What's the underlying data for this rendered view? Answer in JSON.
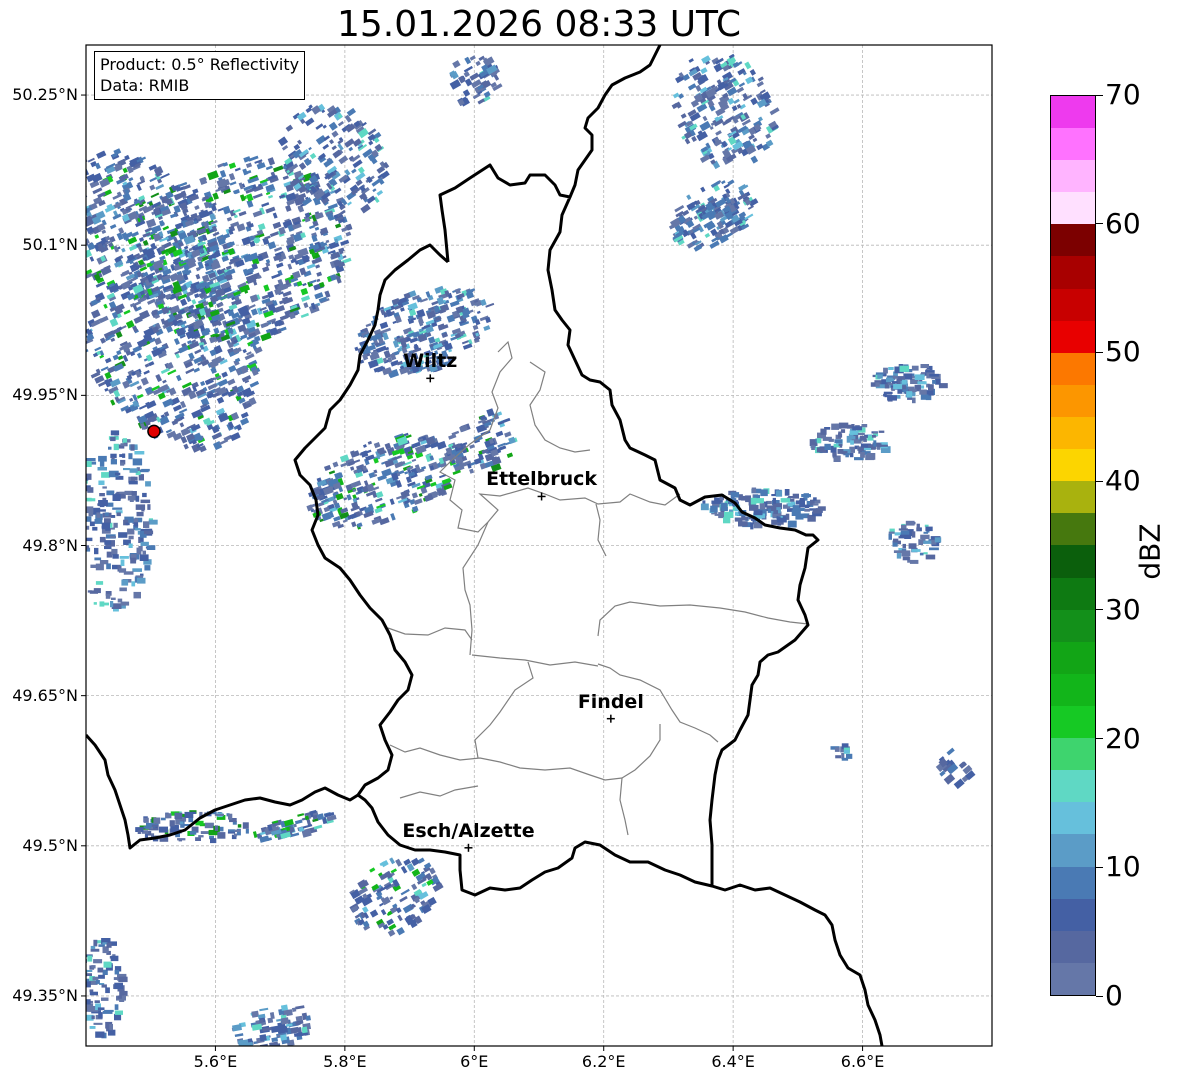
{
  "title": "15.01.2026 08:33 UTC",
  "info": {
    "product": "Product: 0.5° Reflectivity",
    "source": "Data: RMIB"
  },
  "map": {
    "lon_range": [
      5.4,
      6.8
    ],
    "lat_range": [
      49.3,
      50.3
    ],
    "x_ticks": [
      {
        "value": 5.6,
        "label": "5.6°E"
      },
      {
        "value": 5.8,
        "label": "5.8°E"
      },
      {
        "value": 6.0,
        "label": "6°E"
      },
      {
        "value": 6.2,
        "label": "6.2°E"
      },
      {
        "value": 6.4,
        "label": "6.4°E"
      },
      {
        "value": 6.6,
        "label": "6.6°E"
      }
    ],
    "y_ticks": [
      {
        "value": 50.25,
        "label": "50.25°N"
      },
      {
        "value": 50.1,
        "label": "50.1°N"
      },
      {
        "value": 49.95,
        "label": "49.95°N"
      },
      {
        "value": 49.8,
        "label": "49.8°N"
      },
      {
        "value": 49.65,
        "label": "49.65°N"
      },
      {
        "value": 49.5,
        "label": "49.5°N"
      },
      {
        "value": 49.35,
        "label": "49.35°N"
      }
    ],
    "grid": true,
    "radar_site": {
      "lon": 5.505,
      "lat": 49.914
    },
    "cities": [
      {
        "name": "Wiltz",
        "lon": 5.932,
        "lat": 49.967
      },
      {
        "name": "Ettelbruck",
        "lon": 6.104,
        "lat": 49.849
      },
      {
        "name": "Findel",
        "lon": 6.211,
        "lat": 49.627
      },
      {
        "name": "Esch/Alzette",
        "lon": 5.991,
        "lat": 49.498
      }
    ]
  },
  "colorbar": {
    "unit": "dBZ",
    "min": 0,
    "max": 70,
    "step": 2.5,
    "ticks": [
      {
        "value": 0,
        "label": "0"
      },
      {
        "value": 10,
        "label": "10"
      },
      {
        "value": 20,
        "label": "20"
      },
      {
        "value": 30,
        "label": "30"
      },
      {
        "value": 40,
        "label": "40"
      },
      {
        "value": 50,
        "label": "50"
      },
      {
        "value": 60,
        "label": "60"
      },
      {
        "value": 70,
        "label": "70"
      }
    ],
    "colors": [
      "#6577a8",
      "#5668a0",
      "#4460a4",
      "#4a7ab4",
      "#5b9cc7",
      "#66c0dc",
      "#5fd8c4",
      "#3ed46e",
      "#16c924",
      "#12b51a",
      "#12a516",
      "#13901a",
      "#0e7a12",
      "#0b5f0c",
      "#46780e",
      "#a9b20e",
      "#fcd500",
      "#fcb600",
      "#fc9600",
      "#fc7800",
      "#e80000",
      "#c80000",
      "#a80000",
      "#7c0000",
      "#ffe0ff",
      "#ffb4ff",
      "#ff72ff",
      "#ee3aee"
    ]
  }
}
